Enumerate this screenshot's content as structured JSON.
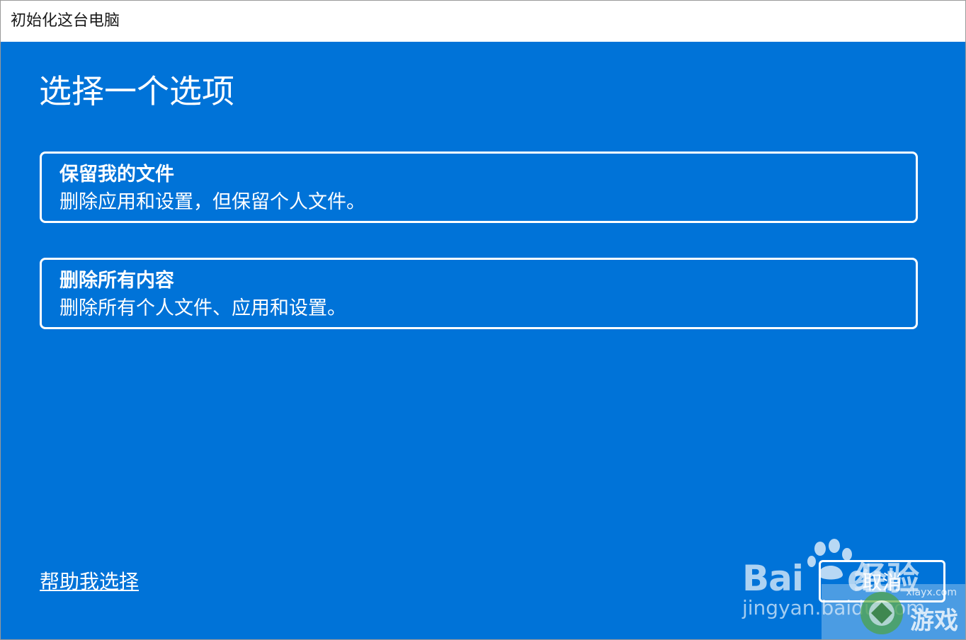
{
  "window": {
    "title": "初始化这台电脑"
  },
  "main": {
    "heading": "选择一个选项",
    "options": [
      {
        "title": "保留我的文件",
        "description": "删除应用和设置，但保留个人文件。"
      },
      {
        "title": "删除所有内容",
        "description": "删除所有个人文件、应用和设置。"
      }
    ],
    "help_link": "帮助我选择",
    "cancel_label": "取消"
  },
  "watermark": {
    "baidu": "Bai",
    "du": "du",
    "jingyan": "经验",
    "url": "jingyan.baidu.com",
    "site": "xlayx.com",
    "game": "游戏"
  },
  "colors": {
    "background": "#0073d8",
    "foreground": "#ffffff",
    "titlebar": "#ffffff"
  }
}
